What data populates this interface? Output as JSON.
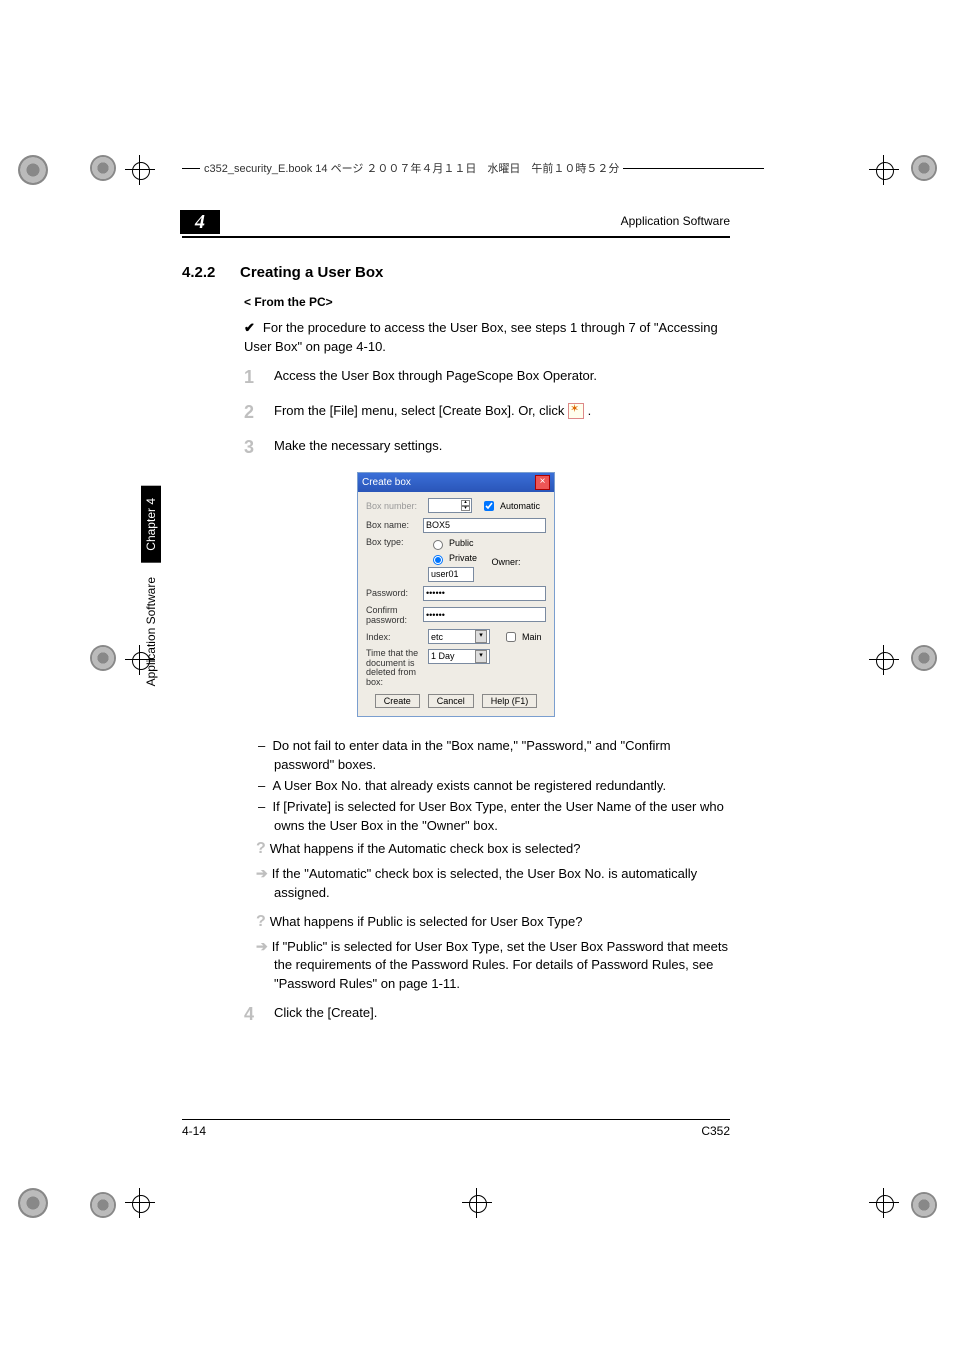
{
  "running_header": "c352_security_E.book  14 ページ  ２００７年４月１１日　水曜日　午前１０時５２分",
  "chapter_number": "4",
  "header_right": "Application Software",
  "section": {
    "num": "4.2.2",
    "title": "Creating a User Box"
  },
  "sub_title": "< From the PC>",
  "check_line": "For the procedure to access the User Box, see steps 1 through 7 of \"Accessing User Box\" on page 4-10.",
  "steps": [
    {
      "n": "1",
      "t": "Access the User Box through PageScope Box Operator."
    },
    {
      "n": "2",
      "t": "From the [File] menu, select [Create Box]. Or, click "
    },
    {
      "n": "3",
      "t": "Make the necessary settings."
    }
  ],
  "step2_tail": " .",
  "dialog": {
    "title": "Create box",
    "box_number_lab": "Box number:",
    "automatic": "Automatic",
    "box_name_lab": "Box name:",
    "box_name_val": "BOX5",
    "box_type_lab": "Box type:",
    "public": "Public",
    "private": "Private",
    "owner_lab": "Owner:",
    "owner_val": "user01",
    "password_lab": "Password:",
    "password_val": "••••••",
    "confirm_lab": "Confirm password:",
    "confirm_val": "••••••",
    "index_lab": "Index:",
    "index_val": "etc",
    "main": "Main",
    "time_lab1": "Time that the",
    "time_lab2": "document is",
    "time_lab3": "deleted from box:",
    "time_val": "1 Day",
    "btn_create": "Create",
    "btn_cancel": "Cancel",
    "btn_help": "Help (F1)"
  },
  "notes": {
    "d1": "Do not fail to enter data in the \"Box name,\" \"Password,\" and \"Confirm password\" boxes.",
    "d2": "A User Box No. that already exists cannot be registered redundantly.",
    "d3": "If [Private] is selected for User Box Type, enter the User Name of the user who owns the User Box in the \"Owner\" box.",
    "q1": "What happens if the Automatic check box is selected?",
    "a1": "If the \"Automatic\" check box is selected, the User Box No. is automatically assigned.",
    "q2": "What happens if Public is selected for User Box Type?",
    "a2": "If \"Public\" is selected for User Box Type, set the User Box Password that meets the requirements of the Password Rules. For details of Password Rules, see \"Password Rules\" on page 1-11."
  },
  "step4": {
    "n": "4",
    "t": "Click the [Create]."
  },
  "side": {
    "black": "Chapter 4",
    "white": "Application Software"
  },
  "footer": {
    "left": "4-14",
    "right": "C352"
  }
}
